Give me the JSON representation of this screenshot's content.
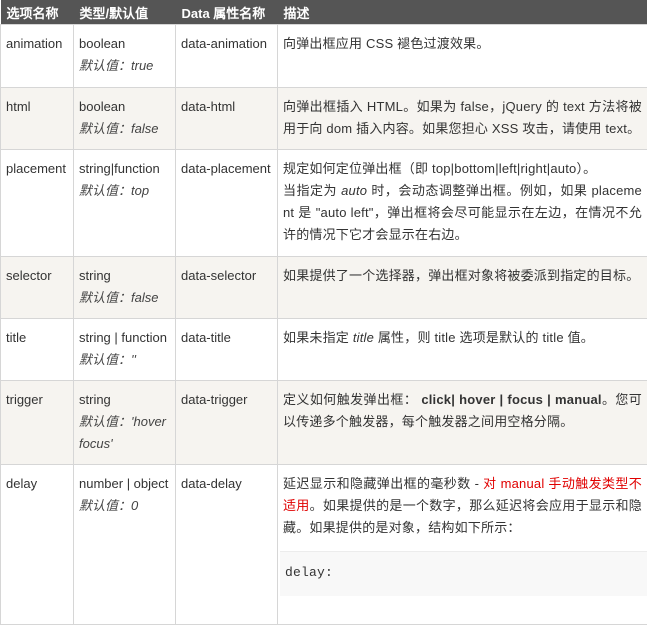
{
  "header": {
    "col1": "选项名称",
    "col2": "类型/默认值",
    "col3": "Data 属性名称",
    "col4": "描述"
  },
  "rows": [
    {
      "name": "animation",
      "type": "boolean",
      "default": "默认值：true",
      "data_attr": "data-animation",
      "desc": "向弹出框应用 CSS 褪色过渡效果。"
    },
    {
      "name": "html",
      "type": "boolean",
      "default": "默认值：false",
      "data_attr": "data-html",
      "desc": "向弹出框插入 HTML。如果为 false，jQuery 的 text 方法将被用于向 dom 插入内容。如果您担心 XSS 攻击，请使用 text。"
    },
    {
      "name": "placement",
      "type": "string|function",
      "default": "默认值：top",
      "data_attr": "data-placement",
      "desc_line1": "规定如何定位弹出框（即 top|bottom|left|right|auto）。",
      "desc_line2_pre": "当指定为 ",
      "desc_line2_em": "auto",
      "desc_line2_post": " 时，会动态调整弹出框。例如，如果 placement 是 \"auto left\"，弹出框将会尽可能显示在左边，在情况不允许的情况下它才会显示在右边。"
    },
    {
      "name": "selector",
      "type": "string",
      "default": "默认值：false",
      "data_attr": "data-selector",
      "desc": "如果提供了一个选择器，弹出框对象将被委派到指定的目标。"
    },
    {
      "name": "title",
      "type": "string | function",
      "default": "默认值：''",
      "data_attr": "data-title",
      "desc_pre": "如果未指定 ",
      "desc_em": "title",
      "desc_post": " 属性，则 title 选项是默认的 title 值。"
    },
    {
      "name": "trigger",
      "type": "string",
      "default": "默认值：'hover focus'",
      "data_attr": "data-trigger",
      "desc_pre": "定义如何触发弹出框： ",
      "desc_strong": "click| hover | focus | manual",
      "desc_post": "。您可以传递多个触发器，每个触发器之间用空格分隔。"
    },
    {
      "name": "delay",
      "type": "number | object",
      "default": "默认值：0",
      "data_attr": "data-delay",
      "desc_pre": "延迟显示和隐藏弹出框的毫秒数 - ",
      "desc_red": "对 manual 手动触发类型不适用",
      "desc_post": "。如果提供的是一个数字，那么延迟将会应用于显示和隐藏。如果提供的是对象，结构如下所示：",
      "code": "delay:"
    }
  ]
}
